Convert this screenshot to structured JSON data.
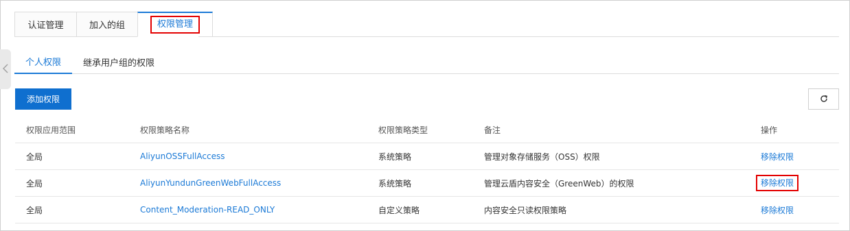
{
  "top_tabs": [
    "认证管理",
    "加入的组",
    "权限管理"
  ],
  "sub_tabs": [
    "个人权限",
    "继承用户组的权限"
  ],
  "toolbar": {
    "add_label": "添加权限",
    "refresh_icon": "refresh-icon"
  },
  "table": {
    "headers": [
      "权限应用范围",
      "权限策略名称",
      "权限策略类型",
      "备注",
      "操作"
    ],
    "rows": [
      {
        "scope": "全局",
        "policy": "AliyunOSSFullAccess",
        "type": "系统策略",
        "note": "管理对象存储服务（OSS）权限",
        "action": "移除权限"
      },
      {
        "scope": "全局",
        "policy": "AliyunYundunGreenWebFullAccess",
        "type": "系统策略",
        "note": "管理云盾内容安全（GreenWeb）的权限",
        "action": "移除权限"
      },
      {
        "scope": "全局",
        "policy": "Content_Moderation-READ_ONLY",
        "type": "自定义策略",
        "note": "内容安全只读权限策略",
        "action": "移除权限"
      }
    ]
  },
  "colors": {
    "accent": "#1a79d6",
    "primary_button": "#0f6fcf",
    "highlight": "#e30000"
  }
}
